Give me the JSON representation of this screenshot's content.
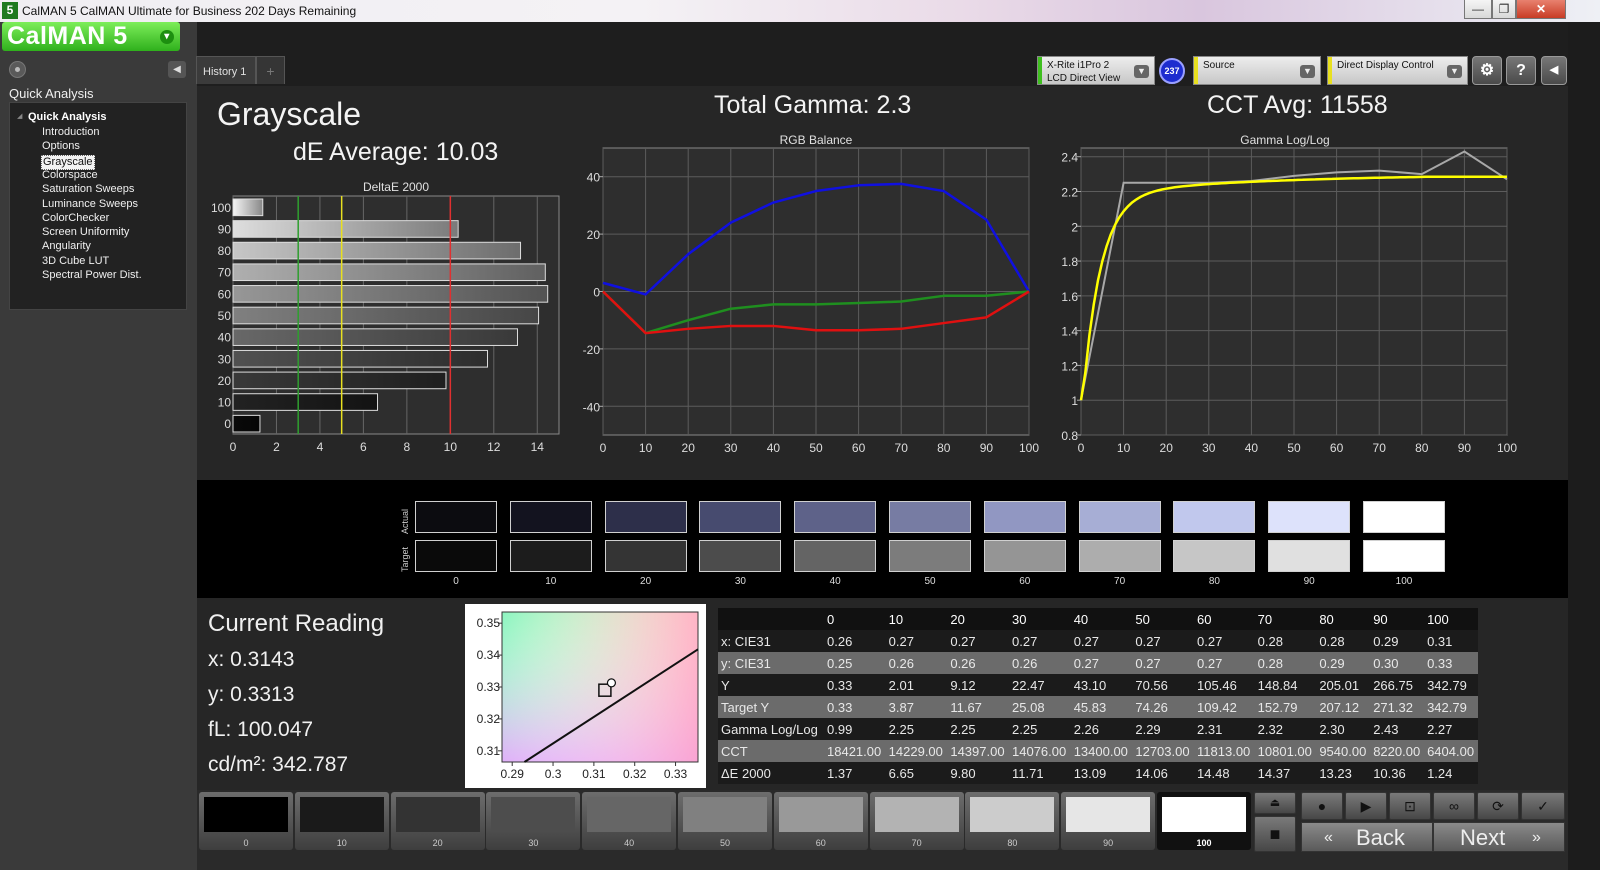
{
  "window": {
    "app_icon": "5",
    "title": "CalMAN 5 CalMAN Ultimate for Business 202 Days Remaining",
    "minimize": "—",
    "maximize": "❐",
    "close": "✕"
  },
  "logo": {
    "text": "CalMAN 5",
    "dropdown": "▾"
  },
  "sidebar": {
    "heading": "Quick Analysis",
    "tree_root": "Quick Analysis",
    "items": [
      {
        "label": "Introduction",
        "selected": false
      },
      {
        "label": "Options",
        "selected": false
      },
      {
        "label": "Grayscale",
        "selected": true
      },
      {
        "label": "Colorspace",
        "selected": false
      },
      {
        "label": "Saturation Sweeps",
        "selected": false
      },
      {
        "label": "Luminance Sweeps",
        "selected": false
      },
      {
        "label": "ColorChecker",
        "selected": false
      },
      {
        "label": "Screen Uniformity",
        "selected": false
      },
      {
        "label": "Angularity",
        "selected": false
      },
      {
        "label": "3D Cube LUT",
        "selected": false
      },
      {
        "label": "Spectral Power Dist.",
        "selected": false
      }
    ]
  },
  "tabs": {
    "history": "History 1",
    "add": "+"
  },
  "devices": {
    "meter_line1": "X-Rite i1Pro 2",
    "meter_line2": "LCD Direct View",
    "meter_badge": "237",
    "source": "Source",
    "display": "Direct Display Control",
    "colors": {
      "meter": "#3fbf1f",
      "source": "#e8e020",
      "display": "#e8e020"
    }
  },
  "main": {
    "page_title": "Grayscale",
    "de_average": "dE Average: 10.03",
    "total_gamma": "Total Gamma: 2.3",
    "cct_avg": "CCT Avg: 11558"
  },
  "deltae_chart": {
    "title": "DeltaE 2000",
    "type": "bar",
    "orientation": "horizontal",
    "categories": [
      "0",
      "10",
      "20",
      "30",
      "40",
      "50",
      "60",
      "70",
      "80",
      "90",
      "100"
    ],
    "values": [
      1.24,
      6.65,
      9.8,
      11.71,
      13.09,
      14.06,
      14.48,
      14.37,
      13.23,
      10.36,
      1.37
    ],
    "xlim": [
      0,
      15
    ],
    "xticks": [
      "0",
      "2",
      "4",
      "6",
      "8",
      "10",
      "12",
      "14"
    ],
    "threshold_lines": [
      {
        "value": 3,
        "color": "#2f9e2f"
      },
      {
        "value": 5,
        "color": "#e8e020"
      },
      {
        "value": 10,
        "color": "#e03030"
      }
    ]
  },
  "rgb_chart": {
    "title": "RGB Balance",
    "type": "line",
    "x": [
      0,
      10,
      20,
      30,
      40,
      50,
      60,
      70,
      80,
      90,
      100
    ],
    "xticks": [
      "0",
      "10",
      "20",
      "30",
      "40",
      "50",
      "60",
      "70",
      "80",
      "90",
      "100"
    ],
    "yticks": [
      "40",
      "20",
      "0",
      "-20",
      "-40"
    ],
    "ylim": [
      -50,
      50
    ],
    "series": [
      {
        "color": "#1010e0",
        "values": [
          3,
          -1,
          13,
          24,
          31,
          35,
          37,
          37.5,
          35,
          25,
          0
        ]
      },
      {
        "color": "#1f8f1f",
        "values": [
          0,
          -14.5,
          -10,
          -6,
          -4.5,
          -4.5,
          -4,
          -3.5,
          -1.5,
          -1.5,
          0
        ]
      },
      {
        "color": "#e01010",
        "values": [
          0,
          -14.5,
          -13,
          -12,
          -12,
          -13.5,
          -13.5,
          -13,
          -11,
          -9,
          0
        ]
      }
    ]
  },
  "gamma_chart": {
    "title": "Gamma Log/Log",
    "type": "line",
    "x": [
      0,
      10,
      20,
      30,
      40,
      50,
      60,
      70,
      80,
      90,
      100
    ],
    "xticks": [
      "0",
      "10",
      "20",
      "30",
      "40",
      "50",
      "60",
      "70",
      "80",
      "90",
      "100"
    ],
    "yticks": [
      "2.4",
      "2.2",
      "2",
      "1.8",
      "1.6",
      "1.4",
      "1.2",
      "1",
      "0.8"
    ],
    "ylim": [
      0.8,
      2.45
    ],
    "series": [
      {
        "color": "#a8a8a8",
        "values": [
          1.0,
          2.25,
          2.25,
          2.25,
          2.26,
          2.29,
          2.31,
          2.32,
          2.3,
          2.43,
          2.27
        ]
      },
      {
        "color": "#ffff00",
        "values": [
          1.0,
          1.9,
          2.08,
          2.15,
          2.19,
          2.21,
          2.23,
          2.245,
          2.255,
          2.265,
          2.275
        ]
      }
    ]
  },
  "swatches": {
    "actual_label": "Actual",
    "target_label": "Target",
    "levels": [
      "0",
      "10",
      "20",
      "30",
      "40",
      "50",
      "60",
      "70",
      "80",
      "90",
      "100"
    ],
    "actual_colors": [
      "#0c0c10",
      "#13131f",
      "#2d2f4a",
      "#474b6f",
      "#5e6289",
      "#777ca3",
      "#9197c2",
      "#a7aed5",
      "#c1c8ed",
      "#dde2fb",
      "#ffffff"
    ],
    "target_colors": [
      "#0a0a0a",
      "#1c1c1c",
      "#343434",
      "#4c4c4c",
      "#646464",
      "#7c7c7c",
      "#959595",
      "#adadad",
      "#c6c6c6",
      "#e0e0e0",
      "#ffffff"
    ]
  },
  "current_reading": {
    "title": "Current Reading",
    "x": "x: 0.3143",
    "y": "y: 0.3313",
    "fl": "fL: 100.047",
    "cdm2": "cd/m²: 342.787"
  },
  "cie_plot": {
    "xticks": [
      "0.29",
      "0.3",
      "0.31",
      "0.32",
      "0.33"
    ],
    "yticks": [
      "0.35",
      "0.34",
      "0.33",
      "0.32",
      "0.31"
    ],
    "xlim": [
      0.2875,
      0.3355
    ],
    "ylim": [
      0.3065,
      0.3535
    ],
    "target": {
      "x": 0.3127,
      "y": 0.329
    },
    "measured": {
      "x": 0.3143,
      "y": 0.3313
    },
    "locus": [
      [
        0.293,
        0.3065
      ],
      [
        0.3355,
        0.3418
      ]
    ]
  },
  "table": {
    "columns": [
      "",
      "0",
      "10",
      "20",
      "30",
      "40",
      "50",
      "60",
      "70",
      "80",
      "90",
      "100"
    ],
    "rows": [
      [
        "x: CIE31",
        "0.26",
        "0.27",
        "0.27",
        "0.27",
        "0.27",
        "0.27",
        "0.27",
        "0.28",
        "0.28",
        "0.29",
        "0.31"
      ],
      [
        "y: CIE31",
        "0.25",
        "0.26",
        "0.26",
        "0.26",
        "0.27",
        "0.27",
        "0.27",
        "0.28",
        "0.29",
        "0.30",
        "0.33"
      ],
      [
        "Y",
        "0.33",
        "2.01",
        "9.12",
        "22.47",
        "43.10",
        "70.56",
        "105.46",
        "148.84",
        "205.01",
        "266.75",
        "342.79"
      ],
      [
        "Target Y",
        "0.33",
        "3.87",
        "11.67",
        "25.08",
        "45.83",
        "74.26",
        "109.42",
        "152.79",
        "207.12",
        "271.32",
        "342.79"
      ],
      [
        "Gamma Log/Log",
        "0.99",
        "2.25",
        "2.25",
        "2.25",
        "2.26",
        "2.29",
        "2.31",
        "2.32",
        "2.30",
        "2.43",
        "2.27"
      ],
      [
        "CCT",
        "18421.00",
        "14229.00",
        "14397.00",
        "14076.00",
        "13400.00",
        "12703.00",
        "11813.00",
        "10801.00",
        "9540.00",
        "8220.00",
        "6404.00"
      ],
      [
        "ΔE 2000",
        "1.37",
        "6.65",
        "9.80",
        "11.71",
        "13.09",
        "14.06",
        "14.48",
        "14.37",
        "13.23",
        "10.36",
        "1.24"
      ]
    ]
  },
  "bottom": {
    "levels": [
      "0",
      "10",
      "20",
      "30",
      "40",
      "50",
      "60",
      "70",
      "80",
      "90",
      "100"
    ],
    "colors": [
      "#000000",
      "#1a1a1a",
      "#333333",
      "#4d4d4d",
      "#666666",
      "#808080",
      "#999999",
      "#b3b3b3",
      "#cccccc",
      "#e6e6e6",
      "#ffffff"
    ],
    "active": "100",
    "icons": [
      "eject-icon",
      "stop-icon",
      "play-icon",
      "measure-icon",
      "loop-icon",
      "refresh-icon",
      "check-icon",
      "stop-square-icon"
    ],
    "back_label": "Back",
    "next_label": "Next"
  }
}
